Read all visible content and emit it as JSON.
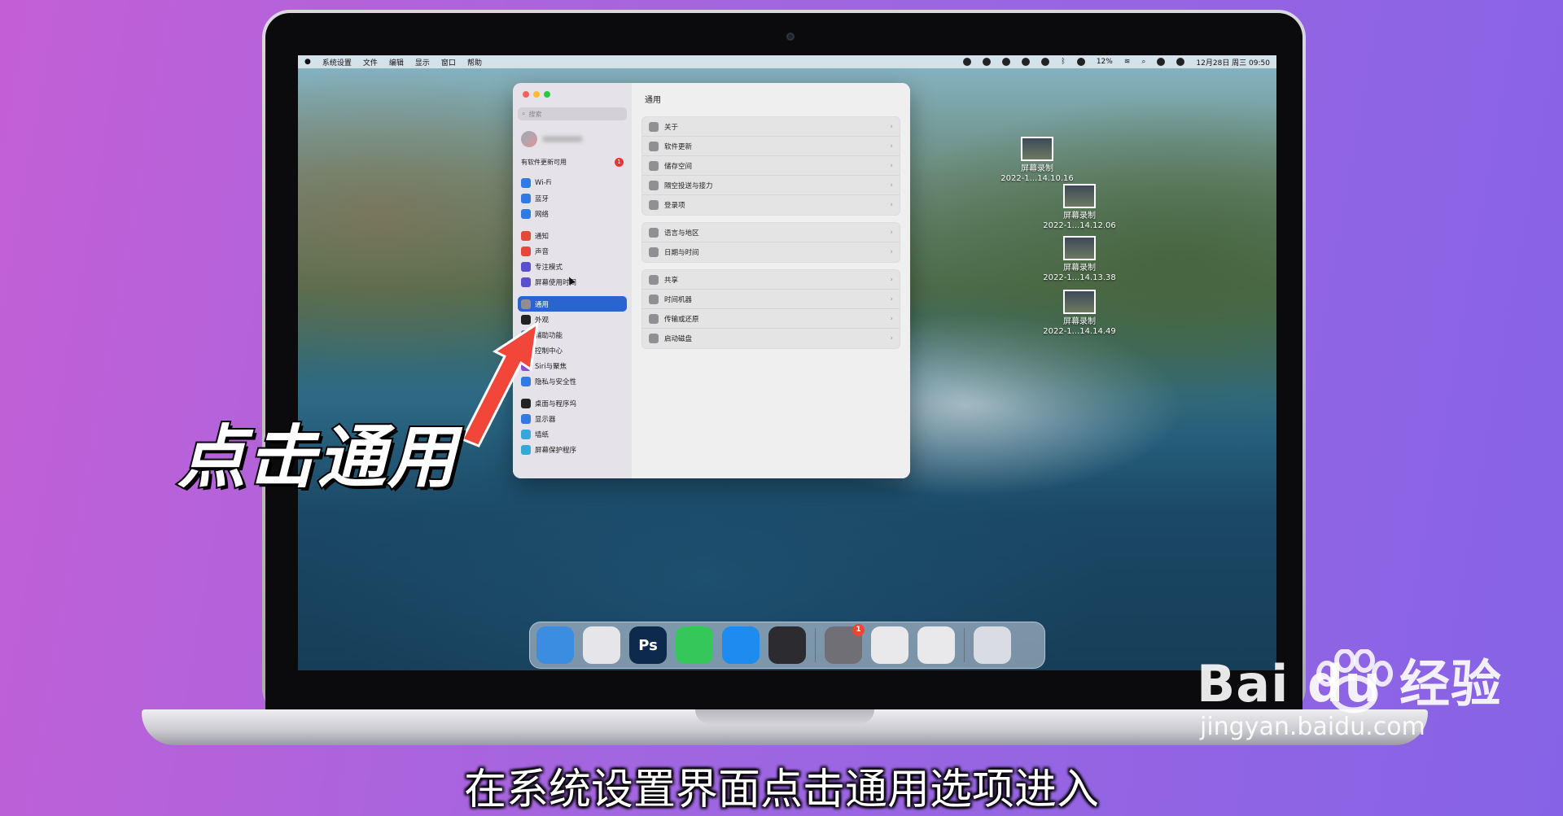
{
  "menubar": {
    "apple": "",
    "items": [
      "系统设置",
      "文件",
      "编辑",
      "显示",
      "窗口",
      "帮助"
    ],
    "battery": "12%",
    "datetime": "12月28日 周三  09:50"
  },
  "window": {
    "search_placeholder": "搜索",
    "update_text": "有软件更新可用",
    "update_badge": "1",
    "title": "通用",
    "sidebar": [
      [
        {
          "label": "Wi-Fi",
          "color": "#2f7ae5"
        },
        {
          "label": "蓝牙",
          "color": "#2f7ae5"
        },
        {
          "label": "网络",
          "color": "#2f7ae5"
        }
      ],
      [
        {
          "label": "通知",
          "color": "#e5483b"
        },
        {
          "label": "声音",
          "color": "#e5483b"
        },
        {
          "label": "专注模式",
          "color": "#5a4fcf"
        },
        {
          "label": "屏幕使用时间",
          "color": "#5a4fcf"
        }
      ],
      [
        {
          "label": "通用",
          "color": "#8e8e93",
          "active": true
        },
        {
          "label": "外观",
          "color": "#222"
        },
        {
          "label": "辅助功能",
          "color": "#2f7ae5"
        },
        {
          "label": "控制中心",
          "color": "#8e8e93"
        },
        {
          "label": "Siri与聚焦",
          "color": "#8a4fd0"
        },
        {
          "label": "隐私与安全性",
          "color": "#2f7ae5"
        }
      ],
      [
        {
          "label": "桌面与程序坞",
          "color": "#222"
        },
        {
          "label": "显示器",
          "color": "#2f7ae5"
        },
        {
          "label": "墙纸",
          "color": "#35a8d8"
        },
        {
          "label": "屏幕保护程序",
          "color": "#35a8d8"
        }
      ]
    ],
    "groups": [
      [
        "关于",
        "软件更新",
        "储存空间",
        "隔空投送与接力",
        "登录项"
      ],
      [
        "语言与地区",
        "日期与时间"
      ],
      [
        "共享",
        "时间机器",
        "传输或还原",
        "启动磁盘"
      ]
    ],
    "chevron": "›"
  },
  "desktop": [
    {
      "title": "屏幕录制",
      "sub": "2022-1...14.10.16"
    },
    {
      "title": "屏幕录制",
      "sub": "2022-1...14.12.06"
    },
    {
      "title": "屏幕录制",
      "sub": "2022-1...14.13.38"
    },
    {
      "title": "屏幕录制",
      "sub": "2022-1...14.14.49"
    }
  ],
  "dock": {
    "apps": [
      {
        "name": "finder",
        "label": "",
        "color": "#3a8de0"
      },
      {
        "name": "launchpad",
        "label": "",
        "color": "#e6e6ea"
      },
      {
        "name": "photoshop",
        "label": "Ps",
        "color": "#0d2a4c"
      },
      {
        "name": "messages",
        "label": "",
        "color": "#35c759"
      },
      {
        "name": "safari",
        "label": "",
        "color": "#1e8bf0"
      },
      {
        "name": "quicktime",
        "label": "",
        "color": "#2b2b30"
      }
    ],
    "apps2": [
      {
        "name": "system-settings",
        "label": "",
        "color": "#6f6f75",
        "badge": "1"
      },
      {
        "name": "system-information",
        "label": "",
        "color": "#e9e9ec"
      },
      {
        "name": "disk-utility",
        "label": "",
        "color": "#e9e9ec"
      }
    ],
    "trash": {
      "name": "trash",
      "label": "",
      "color": "#d9dde3"
    }
  },
  "callout": "点击通用",
  "caption": "在系统设置界面点击通用选项进入",
  "watermark": {
    "brand": "Bai  du 经验",
    "url": "jingyan.baidu.com"
  }
}
